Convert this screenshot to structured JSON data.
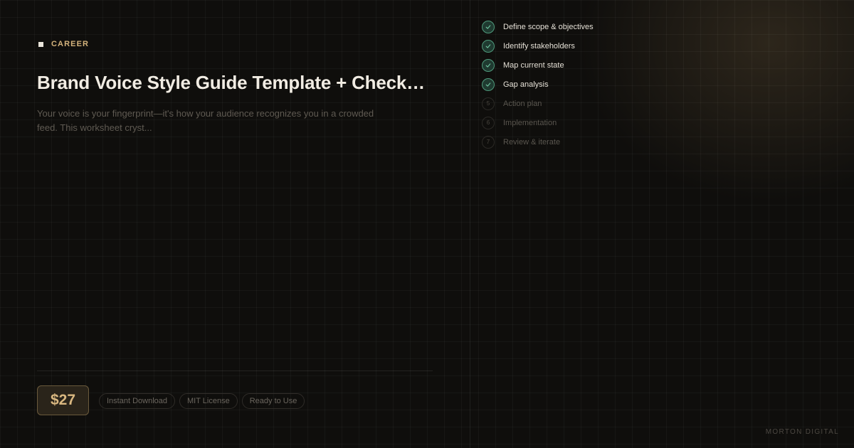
{
  "category": "CAREER",
  "title": "Brand Voice Style Guide Template + Check…",
  "description": "Your voice is your fingerprint—it's how your audience recognizes you in a crowded feed. This worksheet cryst...",
  "price": "$27",
  "tags": [
    "Instant Download",
    "MIT License",
    "Ready to Use"
  ],
  "checklist": [
    {
      "step": "1",
      "label": "Define scope & objectives",
      "done": true
    },
    {
      "step": "2",
      "label": "Identify stakeholders",
      "done": true
    },
    {
      "step": "3",
      "label": "Map current state",
      "done": true
    },
    {
      "step": "4",
      "label": "Gap analysis",
      "done": true
    },
    {
      "step": "5",
      "label": "Action plan",
      "done": false
    },
    {
      "step": "6",
      "label": "Implementation",
      "done": false
    },
    {
      "step": "7",
      "label": "Review & iterate",
      "done": false
    }
  ],
  "brand": "MORTON DIGITAL",
  "colors": {
    "accent_gold": "#d4b37c",
    "done_green": "#4f9a7c",
    "background": "#0f0e0c"
  },
  "icons": {
    "category": "square-icon",
    "done": "checkmark-icon"
  }
}
